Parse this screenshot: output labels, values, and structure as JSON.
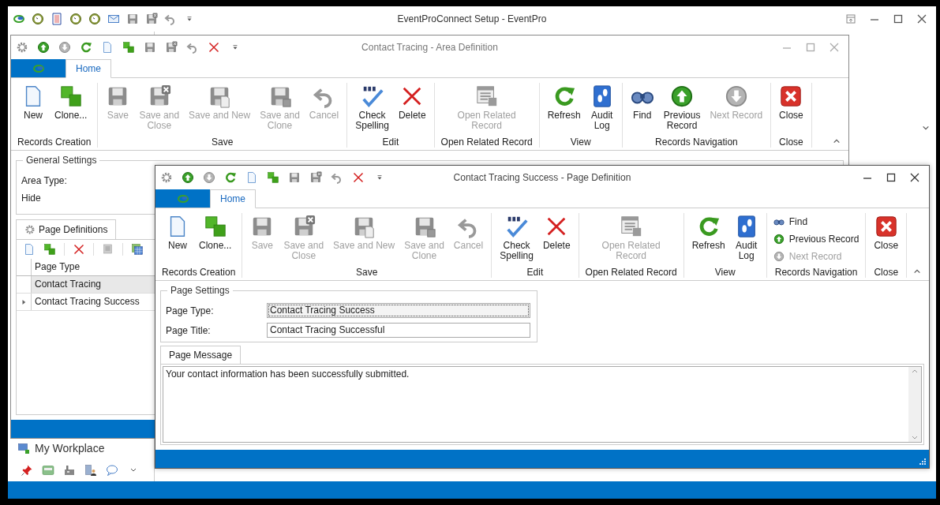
{
  "app": {
    "title": "EventProConnect Setup - EventPro",
    "workplace": "My Workplace"
  },
  "windows": [
    {
      "kind": "area",
      "title": "Contact Tracing - Area Definition",
      "tab": "Home",
      "ribbon": [
        {
          "label": "Records Creation",
          "buttons": [
            {
              "label": "New",
              "kind": "large",
              "disabled": false
            },
            {
              "label": "Clone...",
              "kind": "large",
              "disabled": false
            }
          ]
        },
        {
          "label": "Save",
          "buttons": [
            {
              "label": "Save",
              "kind": "large",
              "disabled": true
            },
            {
              "label": "Save and\nClose",
              "kind": "large",
              "disabled": true
            },
            {
              "label": "Save and New",
              "kind": "large",
              "disabled": true
            },
            {
              "label": "Save and\nClone",
              "kind": "large",
              "disabled": true
            },
            {
              "label": "Cancel",
              "kind": "large",
              "disabled": true
            }
          ]
        },
        {
          "label": "Edit",
          "buttons": [
            {
              "label": "Check\nSpelling",
              "kind": "large",
              "disabled": false
            },
            {
              "label": "Delete",
              "kind": "large",
              "disabled": false
            }
          ]
        },
        {
          "label": "Open Related Record",
          "buttons": [
            {
              "label": "Open Related\nRecord",
              "kind": "large",
              "disabled": true
            }
          ]
        },
        {
          "label": "View",
          "buttons": [
            {
              "label": "Refresh",
              "kind": "large",
              "disabled": false
            },
            {
              "label": "Audit\nLog",
              "kind": "large",
              "disabled": false
            }
          ]
        },
        {
          "label": "Records Navigation",
          "buttons": [
            {
              "label": "Find",
              "kind": "large",
              "disabled": false
            },
            {
              "label": "Previous\nRecord",
              "kind": "large",
              "disabled": false
            },
            {
              "label": "Next Record",
              "kind": "large",
              "disabled": true
            }
          ]
        },
        {
          "label": "Close",
          "buttons": [
            {
              "label": "Close",
              "kind": "large",
              "disabled": false
            }
          ]
        }
      ],
      "general_settings": {
        "legend": "General Settings",
        "area_type_label": "Area Type:",
        "hide_label": "Hide"
      },
      "page_definitions": {
        "tab": "Page Definitions",
        "column": "Page Type",
        "rows": [
          {
            "text": "Contact Tracing",
            "selected": true,
            "current": false
          },
          {
            "text": "Contact Tracing Success",
            "selected": false,
            "current": true
          }
        ]
      }
    },
    {
      "kind": "page",
      "title": "Contact Tracing Success - Page Definition",
      "tab": "Home",
      "ribbon": [
        {
          "label": "Records Creation",
          "buttons": [
            {
              "label": "New",
              "kind": "large",
              "disabled": false
            },
            {
              "label": "Clone...",
              "kind": "large",
              "disabled": false
            }
          ]
        },
        {
          "label": "Save",
          "buttons": [
            {
              "label": "Save",
              "kind": "large",
              "disabled": true
            },
            {
              "label": "Save and\nClose",
              "kind": "large",
              "disabled": true
            },
            {
              "label": "Save and New",
              "kind": "large",
              "disabled": true
            },
            {
              "label": "Save and\nClone",
              "kind": "large",
              "disabled": true
            },
            {
              "label": "Cancel",
              "kind": "large",
              "disabled": true
            }
          ]
        },
        {
          "label": "Edit",
          "buttons": [
            {
              "label": "Check\nSpelling",
              "kind": "large",
              "disabled": false
            },
            {
              "label": "Delete",
              "kind": "large",
              "disabled": false
            }
          ]
        },
        {
          "label": "Open Related Record",
          "buttons": [
            {
              "label": "Open Related\nRecord",
              "kind": "large",
              "disabled": true
            }
          ]
        },
        {
          "label": "View",
          "buttons": [
            {
              "label": "Refresh",
              "kind": "large",
              "disabled": false
            },
            {
              "label": "Audit\nLog",
              "kind": "large",
              "disabled": false
            }
          ]
        },
        {
          "label": "Records Navigation",
          "buttons": [
            {
              "label": "Find",
              "kind": "small",
              "disabled": false
            },
            {
              "label": "Previous Record",
              "kind": "small",
              "disabled": false
            },
            {
              "label": "Next Record",
              "kind": "small",
              "disabled": true
            }
          ]
        },
        {
          "label": "Close",
          "buttons": [
            {
              "label": "Close",
              "kind": "large",
              "disabled": false
            }
          ]
        }
      ],
      "page_settings": {
        "legend": "Page Settings",
        "fields": [
          {
            "label": "Page Type:",
            "value": "Contact Tracing Success",
            "focused": true
          },
          {
            "label": "Page Title:",
            "value": "Contact Tracing Successful",
            "focused": false
          }
        ]
      },
      "message": {
        "tab": "Page Message",
        "value": "Your contact information has been successfully submitted."
      }
    }
  ]
}
